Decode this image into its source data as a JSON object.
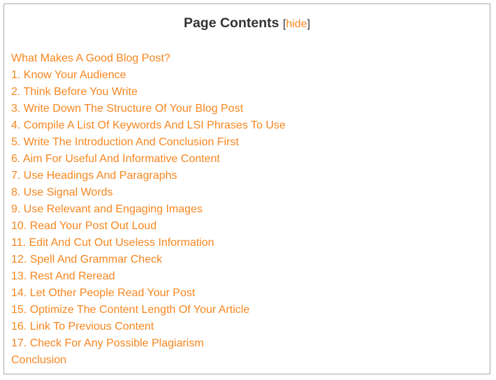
{
  "toc": {
    "title": "Page Contents",
    "toggle_open": "[",
    "toggle_label": "hide",
    "toggle_close": "]",
    "link_color": "#f7861f",
    "items": [
      {
        "label": "What Makes A Good Blog Post?"
      },
      {
        "label": "1. Know Your Audience"
      },
      {
        "label": "2. Think Before You Write"
      },
      {
        "label": "3. Write Down The Structure Of Your Blog Post"
      },
      {
        "label": "4. Compile A List Of Keywords And LSI Phrases To Use"
      },
      {
        "label": "5. Write The Introduction And Conclusion First"
      },
      {
        "label": "6. Aim For Useful And Informative Content"
      },
      {
        "label": "7. Use Headings And Paragraphs"
      },
      {
        "label": "8. Use Signal Words"
      },
      {
        "label": "9. Use Relevant and Engaging Images"
      },
      {
        "label": "10. Read Your Post Out Loud"
      },
      {
        "label": "11. Edit And Cut Out Useless Information"
      },
      {
        "label": "12. Spell And Grammar Check"
      },
      {
        "label": "13. Rest And Reread"
      },
      {
        "label": "14. Let Other People Read Your Post"
      },
      {
        "label": "15. Optimize The Content Length Of Your Article"
      },
      {
        "label": "16. Link To Previous Content"
      },
      {
        "label": "17. Check For Any Possible Plagiarism"
      },
      {
        "label": "Conclusion"
      }
    ]
  }
}
